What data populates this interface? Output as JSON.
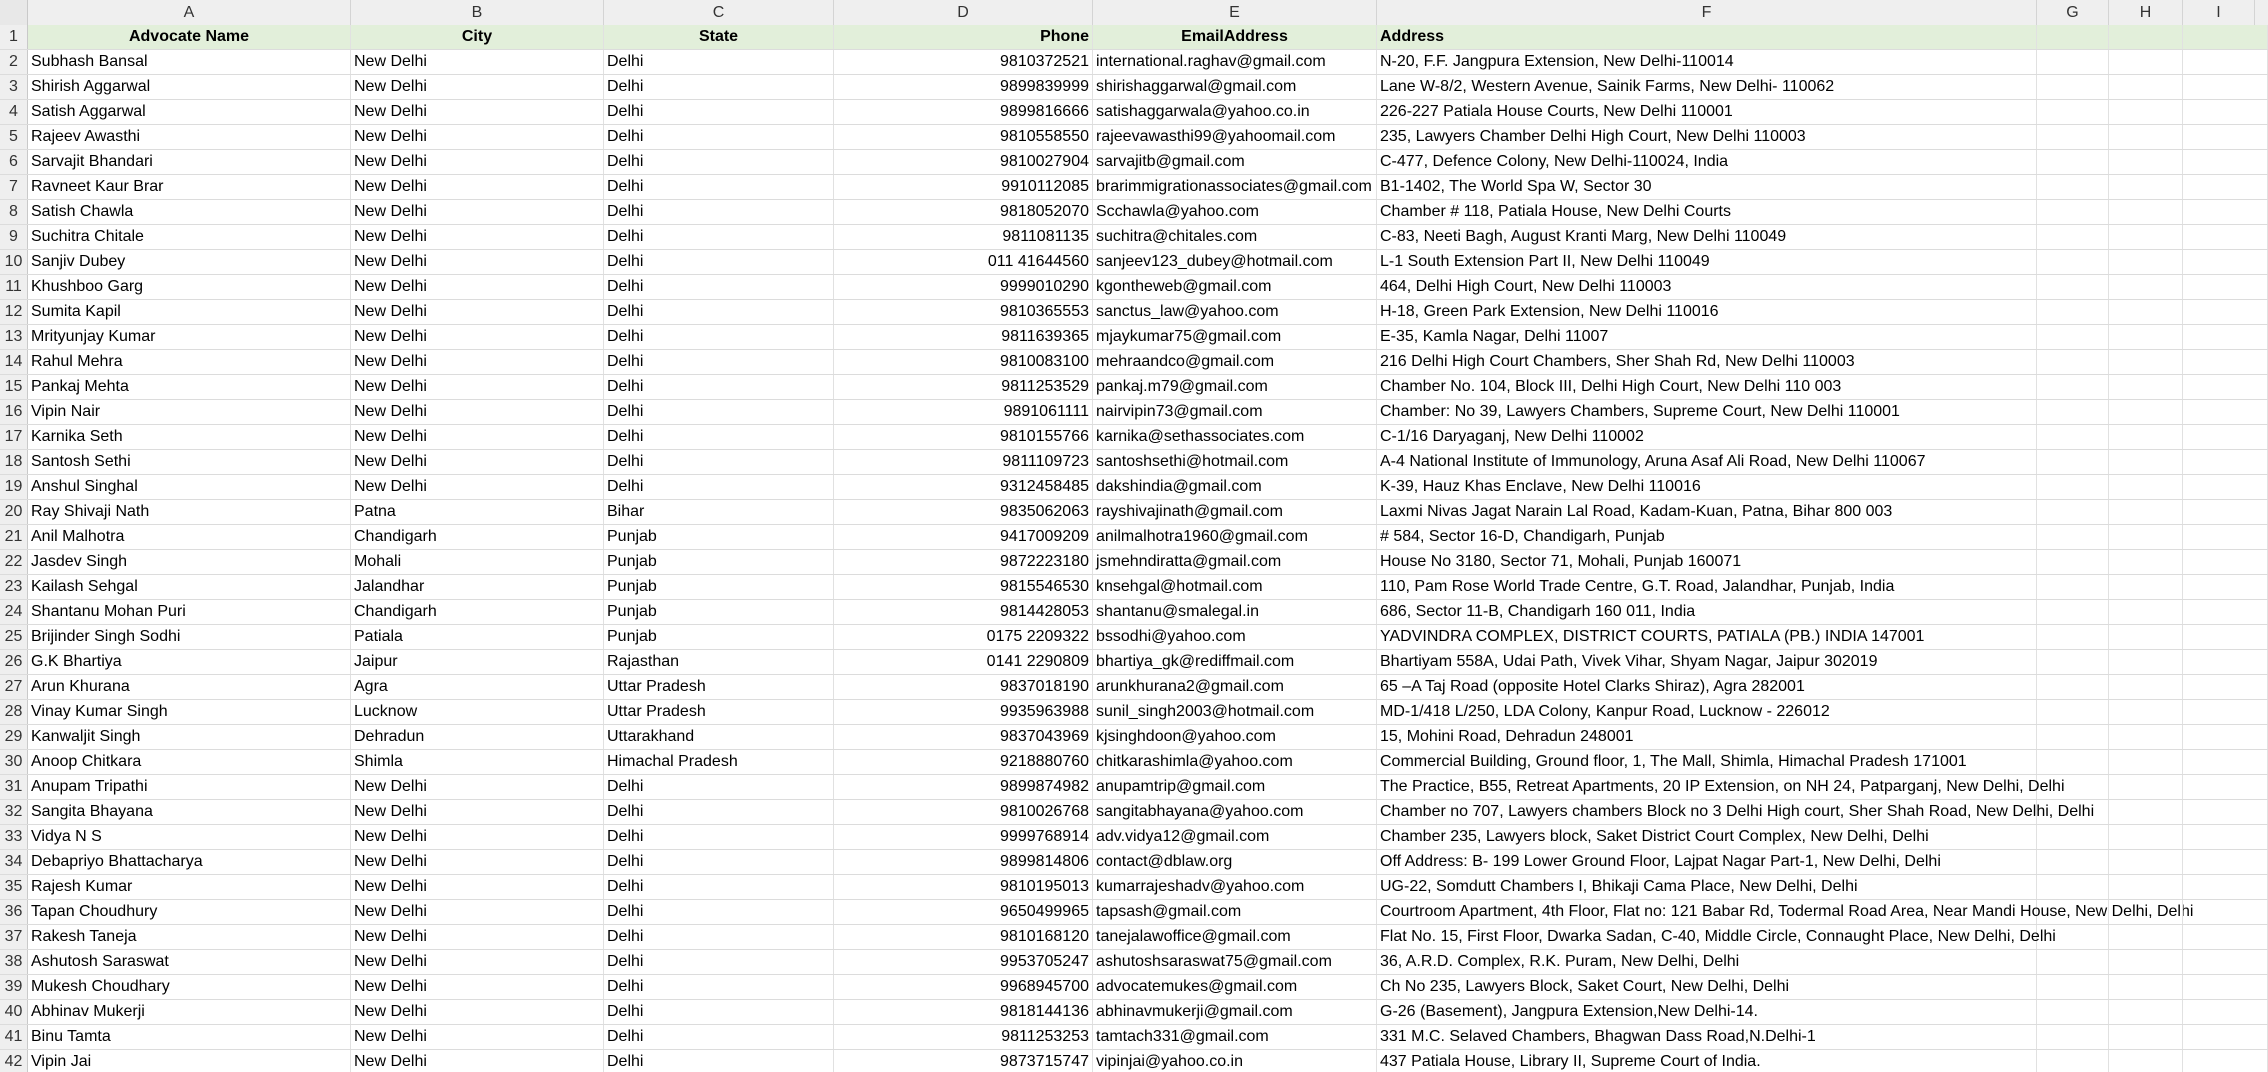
{
  "columns": [
    "A",
    "B",
    "C",
    "D",
    "E",
    "F",
    "G",
    "H",
    "I"
  ],
  "header": {
    "row_number": "1",
    "name": "Advocate Name",
    "city": "City",
    "state": "State",
    "phone": "Phone",
    "email": "EmailAddress",
    "address": "Address"
  },
  "rows": [
    {
      "n": "2",
      "name": "Subhash Bansal",
      "city": "New Delhi",
      "state": "Delhi",
      "phone": "9810372521",
      "email": "international.raghav@gmail.com",
      "address": "N-20, F.F. Jangpura Extension, New Delhi-110014"
    },
    {
      "n": "3",
      "name": "Shirish Aggarwal",
      "city": "New Delhi",
      "state": "Delhi",
      "phone": "9899839999",
      "email": "shirishaggarwal@gmail.com",
      "address": "Lane W-8/2, Western Avenue, Sainik Farms, New Delhi- 110062"
    },
    {
      "n": "4",
      "name": "Satish Aggarwal",
      "city": "New Delhi",
      "state": "Delhi",
      "phone": "9899816666",
      "email": "satishaggarwala@yahoo.co.in",
      "address": "226-227 Patiala House Courts, New Delhi 110001"
    },
    {
      "n": "5",
      "name": "Rajeev Awasthi",
      "city": "New Delhi",
      "state": "Delhi",
      "phone": "9810558550",
      "email": "rajeevawasthi99@yahoomail.com",
      "address": "235, Lawyers Chamber Delhi High Court, New Delhi 110003"
    },
    {
      "n": "6",
      "name": "Sarvajit Bhandari",
      "city": "New Delhi",
      "state": "Delhi",
      "phone": "9810027904",
      "email": "sarvajitb@gmail.com",
      "address": " C-477, Defence Colony, New Delhi-110024, India"
    },
    {
      "n": "7",
      "name": "Ravneet Kaur Brar",
      "city": "New Delhi",
      "state": "Delhi",
      "phone": "9910112085",
      "email": "brarimmigrationassociates@gmail.com",
      "address": "B1-1402, The World Spa W, Sector 30"
    },
    {
      "n": "8",
      "name": "Satish Chawla",
      "city": "New Delhi",
      "state": "Delhi",
      "phone": "9818052070",
      "email": "Scchawla@yahoo.com",
      "address": "Chamber # 118, Patiala House, New Delhi Courts"
    },
    {
      "n": "9",
      "name": "Suchitra Chitale",
      "city": "New Delhi",
      "state": "Delhi",
      "phone": "9811081135",
      "email": "suchitra@chitales.com",
      "address": "C-83, Neeti Bagh, August Kranti Marg, New Delhi 110049"
    },
    {
      "n": "10",
      "name": "Sanjiv Dubey",
      "city": "New Delhi",
      "state": "Delhi",
      "phone": "011 41644560",
      "email": "sanjeev123_dubey@hotmail.com",
      "address": "L-1 South Extension Part II, New Delhi 110049"
    },
    {
      "n": "11",
      "name": "Khushboo Garg",
      "city": "New Delhi",
      "state": "Delhi",
      "phone": "9999010290",
      "email": "kgontheweb@gmail.com",
      "address": "464, Delhi High Court, New Delhi 110003"
    },
    {
      "n": "12",
      "name": "Sumita Kapil",
      "city": "New Delhi",
      "state": "Delhi",
      "phone": "9810365553",
      "email": "sanctus_law@yahoo.com",
      "address": "H-18, Green Park Extension, New Delhi 110016"
    },
    {
      "n": "13",
      "name": "Mrityunjay Kumar",
      "city": "New Delhi",
      "state": "Delhi",
      "phone": "9811639365",
      "email": "mjaykumar75@gmail.com",
      "address": "E-35, Kamla Nagar, Delhi 11007"
    },
    {
      "n": "14",
      "name": "Rahul Mehra",
      "city": "New Delhi",
      "state": "Delhi",
      "phone": "9810083100",
      "email": "mehraandco@gmail.com",
      "address": "216 Delhi High Court Chambers, Sher Shah Rd, New Delhi 110003"
    },
    {
      "n": "15",
      "name": "Pankaj Mehta",
      "city": "New Delhi",
      "state": "Delhi",
      "phone": "9811253529",
      "email": "pankaj.m79@gmail.com",
      "address": "Chamber No. 104, Block III, Delhi High Court, New Delhi 110 003"
    },
    {
      "n": "16",
      "name": "Vipin Nair",
      "city": "New Delhi",
      "state": "Delhi",
      "phone": "9891061111",
      "email": "nairvipin73@gmail.com",
      "address": "Chamber: No 39, Lawyers Chambers, Supreme Court, New Delhi 110001"
    },
    {
      "n": "17",
      "name": "Karnika Seth",
      "city": "New Delhi",
      "state": "Delhi",
      "phone": "9810155766",
      "email": "karnika@sethassociates.com",
      "address": "C-1/16 Daryaganj, New Delhi 110002"
    },
    {
      "n": "18",
      "name": "Santosh Sethi",
      "city": "New Delhi",
      "state": "Delhi",
      "phone": "9811109723",
      "email": "santoshsethi@hotmail.com",
      "address": "A-4 National Institute of Immunology, Aruna Asaf Ali Road, New Delhi 110067"
    },
    {
      "n": "19",
      "name": "Anshul Singhal",
      "city": "New Delhi",
      "state": "Delhi",
      "phone": "9312458485",
      "email": "dakshindia@gmail.com",
      "address": "K-39, Hauz Khas Enclave, New Delhi 110016"
    },
    {
      "n": "20",
      "name": "Ray Shivaji Nath",
      "city": "Patna",
      "state": "Bihar",
      "phone": "9835062063",
      "email": "rayshivajinath@gmail.com",
      "address": "Laxmi Nivas Jagat Narain Lal Road, Kadam-Kuan, Patna, Bihar 800 003"
    },
    {
      "n": "21",
      "name": "Anil Malhotra",
      "city": "Chandigarh",
      "state": "Punjab",
      "phone": "9417009209",
      "email": "anilmalhotra1960@gmail.com",
      "address": "# 584, Sector 16-D, Chandigarh, Punjab"
    },
    {
      "n": "22",
      "name": "Jasdev Singh",
      "city": "Mohali",
      "state": "Punjab",
      "phone": "9872223180",
      "email": "jsmehndiratta@gmail.com",
      "address": "House No 3180, Sector 71, Mohali, Punjab 160071"
    },
    {
      "n": "23",
      "name": "Kailash Sehgal",
      "city": "Jalandhar",
      "state": "Punjab",
      "phone": "9815546530",
      "email": "knsehgal@hotmail.com",
      "address": "110, Pam Rose World Trade Centre, G.T. Road, Jalandhar, Punjab, India"
    },
    {
      "n": "24",
      "name": "Shantanu Mohan Puri",
      "city": "Chandigarh",
      "state": "Punjab",
      "phone": "9814428053",
      "email": "shantanu@smalegal.in",
      "address": "686, Sector 11-B, Chandigarh 160 011, India"
    },
    {
      "n": "25",
      "name": "Brijinder Singh Sodhi",
      "city": "Patiala",
      "state": "Punjab",
      "phone": "0175 2209322",
      "email": "bssodhi@yahoo.com",
      "address": "YADVINDRA COMPLEX, DISTRICT COURTS, PATIALA (PB.) INDIA 147001"
    },
    {
      "n": "26",
      "name": "G.K Bhartiya",
      "city": "Jaipur",
      "state": "Rajasthan",
      "phone": "0141 2290809",
      "email": "bhartiya_gk@rediffmail.com",
      "address": "Bhartiyam 558A, Udai Path, Vivek Vihar, Shyam Nagar, Jaipur 302019"
    },
    {
      "n": "27",
      "name": "Arun Khurana",
      "city": "Agra",
      "state": "Uttar Pradesh",
      "phone": "9837018190",
      "email": "arunkhurana2@gmail.com",
      "address": "65 –A Taj Road (opposite Hotel Clarks Shiraz), Agra 282001"
    },
    {
      "n": "28",
      "name": "Vinay Kumar Singh",
      "city": "Lucknow",
      "state": "Uttar Pradesh",
      "phone": "9935963988",
      "email": "sunil_singh2003@hotmail.com",
      "address": "MD-1/418 L/250, LDA Colony, Kanpur Road, Lucknow - 226012"
    },
    {
      "n": "29",
      "name": "Kanwaljit Singh",
      "city": "Dehradun",
      "state": "Uttarakhand",
      "phone": "9837043969",
      "email": "kjsinghdoon@yahoo.com",
      "address": "15, Mohini Road, Dehradun 248001"
    },
    {
      "n": "30",
      "name": "Anoop Chitkara",
      "city": "Shimla",
      "state": "Himachal Pradesh",
      "phone": "9218880760",
      "email": "chitkarashimla@yahoo.com",
      "address": "Commercial Building, Ground floor, 1, The Mall, Shimla, Himachal Pradesh 171001"
    },
    {
      "n": "31",
      "name": "Anupam Tripathi",
      "city": "New Delhi",
      "state": "Delhi",
      "phone": "9899874982",
      "email": "anupamtrip@gmail.com",
      "address": "The Practice, B55, Retreat Apartments, 20 IP Extension, on NH 24, Patparganj, New Delhi, Delhi"
    },
    {
      "n": "32",
      "name": "Sangita Bhayana",
      "city": "New Delhi",
      "state": "Delhi",
      "phone": "9810026768",
      "email": "sangitabhayana@yahoo.com",
      "address": "Chamber no 707, Lawyers chambers Block no 3 Delhi High court, Sher Shah Road, New Delhi, Delhi"
    },
    {
      "n": "33",
      "name": "Vidya N S",
      "city": "New Delhi",
      "state": "Delhi",
      "phone": "9999768914",
      "email": "adv.vidya12@gmail.com",
      "address": "Chamber 235, Lawyers block, Saket District Court Complex, New Delhi, Delhi"
    },
    {
      "n": "34",
      "name": "Debapriyo Bhattacharya",
      "city": "New Delhi",
      "state": "Delhi",
      "phone": "9899814806",
      "email": "contact@dblaw.org",
      "address": "Off Address: B- 199 Lower Ground Floor, Lajpat Nagar Part-1, New Delhi, Delhi"
    },
    {
      "n": "35",
      "name": "Rajesh Kumar",
      "city": "New Delhi",
      "state": "Delhi",
      "phone": "9810195013",
      "email": "kumarrajeshadv@yahoo.com",
      "address": "UG-22, Somdutt Chambers I, Bhikaji Cama Place, New Delhi, Delhi"
    },
    {
      "n": "36",
      "name": "Tapan Choudhury",
      "city": "New Delhi",
      "state": "Delhi",
      "phone": "9650499965",
      "email": "tapsash@gmail.com",
      "address": "Courtroom Apartment, 4th Floor, Flat no: 121 Babar Rd, Todermal Road Area, Near Mandi House, New Delhi, Delhi"
    },
    {
      "n": "37",
      "name": "Rakesh Taneja",
      "city": "New Delhi",
      "state": "Delhi",
      "phone": "9810168120",
      "email": "tanejalawoffice@gmail.com",
      "address": "Flat No. 15, First Floor, Dwarka Sadan, C-40, Middle Circle, Connaught Place, New Delhi, Delhi"
    },
    {
      "n": "38",
      "name": "Ashutosh Saraswat",
      "city": "New Delhi",
      "state": "Delhi",
      "phone": "9953705247",
      "email": "ashutoshsaraswat75@gmail.com",
      "address": "36, A.R.D. Complex, R.K. Puram, New Delhi, Delhi"
    },
    {
      "n": "39",
      "name": "Mukesh Choudhary",
      "city": "New Delhi",
      "state": "Delhi",
      "phone": "9968945700",
      "email": "advocatemukes@gmail.com",
      "address": " Ch No 235, Lawyers Block, Saket Court, New Delhi, Delhi"
    },
    {
      "n": "40",
      "name": "Abhinav Mukerji",
      "city": "New Delhi",
      "state": "Delhi",
      "phone": "9818144136",
      "email": "abhinavmukerji@gmail.com",
      "address": "G-26 (Basement), Jangpura Extension,New Delhi-14."
    },
    {
      "n": "41",
      "name": "Binu Tamta",
      "city": "New Delhi",
      "state": "Delhi",
      "phone": "9811253253",
      "email": "tamtach331@gmail.com",
      "address": "331 M.C. Selaved Chambers, Bhagwan Dass Road,N.Delhi-1"
    },
    {
      "n": "42",
      "name": "Vipin Jai",
      "city": "New Delhi",
      "state": "Delhi",
      "phone": "9873715747",
      "email": "vipinjai@yahoo.co.in",
      "address": "437 Patiala House, Library II, Supreme Court of India."
    }
  ]
}
